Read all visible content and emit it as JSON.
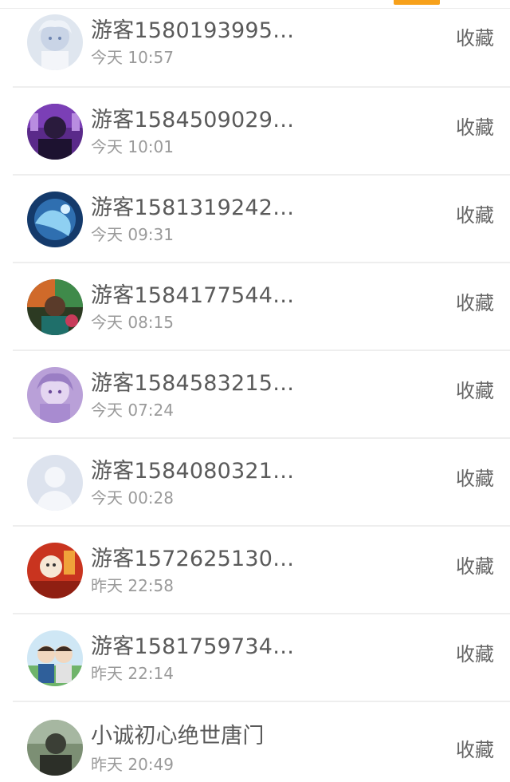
{
  "tab_indicator_color": "#f7a11b",
  "items": [
    {
      "name": "游客1580193995…",
      "time": "今天 10:57",
      "action": "收藏",
      "avatar": "avatar-anime-white-hair"
    },
    {
      "name": "游客1584509029…",
      "time": "今天 10:01",
      "action": "收藏",
      "avatar": "avatar-purple-portrait"
    },
    {
      "name": "游客1581319242…",
      "time": "今天 09:31",
      "action": "收藏",
      "avatar": "avatar-blue-dragon"
    },
    {
      "name": "游客1584177544…",
      "time": "今天 08:15",
      "action": "收藏",
      "avatar": "avatar-colorful-figure"
    },
    {
      "name": "游客1584583215…",
      "time": "今天 07:24",
      "action": "收藏",
      "avatar": "avatar-lavender-anime-girl"
    },
    {
      "name": "游客1584080321…",
      "time": "今天 00:28",
      "action": "收藏",
      "avatar": "avatar-default-placeholder"
    },
    {
      "name": "游客1572625130…",
      "time": "昨天 22:58",
      "action": "收藏",
      "avatar": "avatar-red-cartoon"
    },
    {
      "name": "游客1581759734…",
      "time": "昨天 22:14",
      "action": "收藏",
      "avatar": "avatar-anime-couple"
    },
    {
      "name": "小诚初心绝世唐门",
      "time": "昨天 20:49",
      "action": "收藏",
      "avatar": "avatar-green-photo"
    }
  ]
}
